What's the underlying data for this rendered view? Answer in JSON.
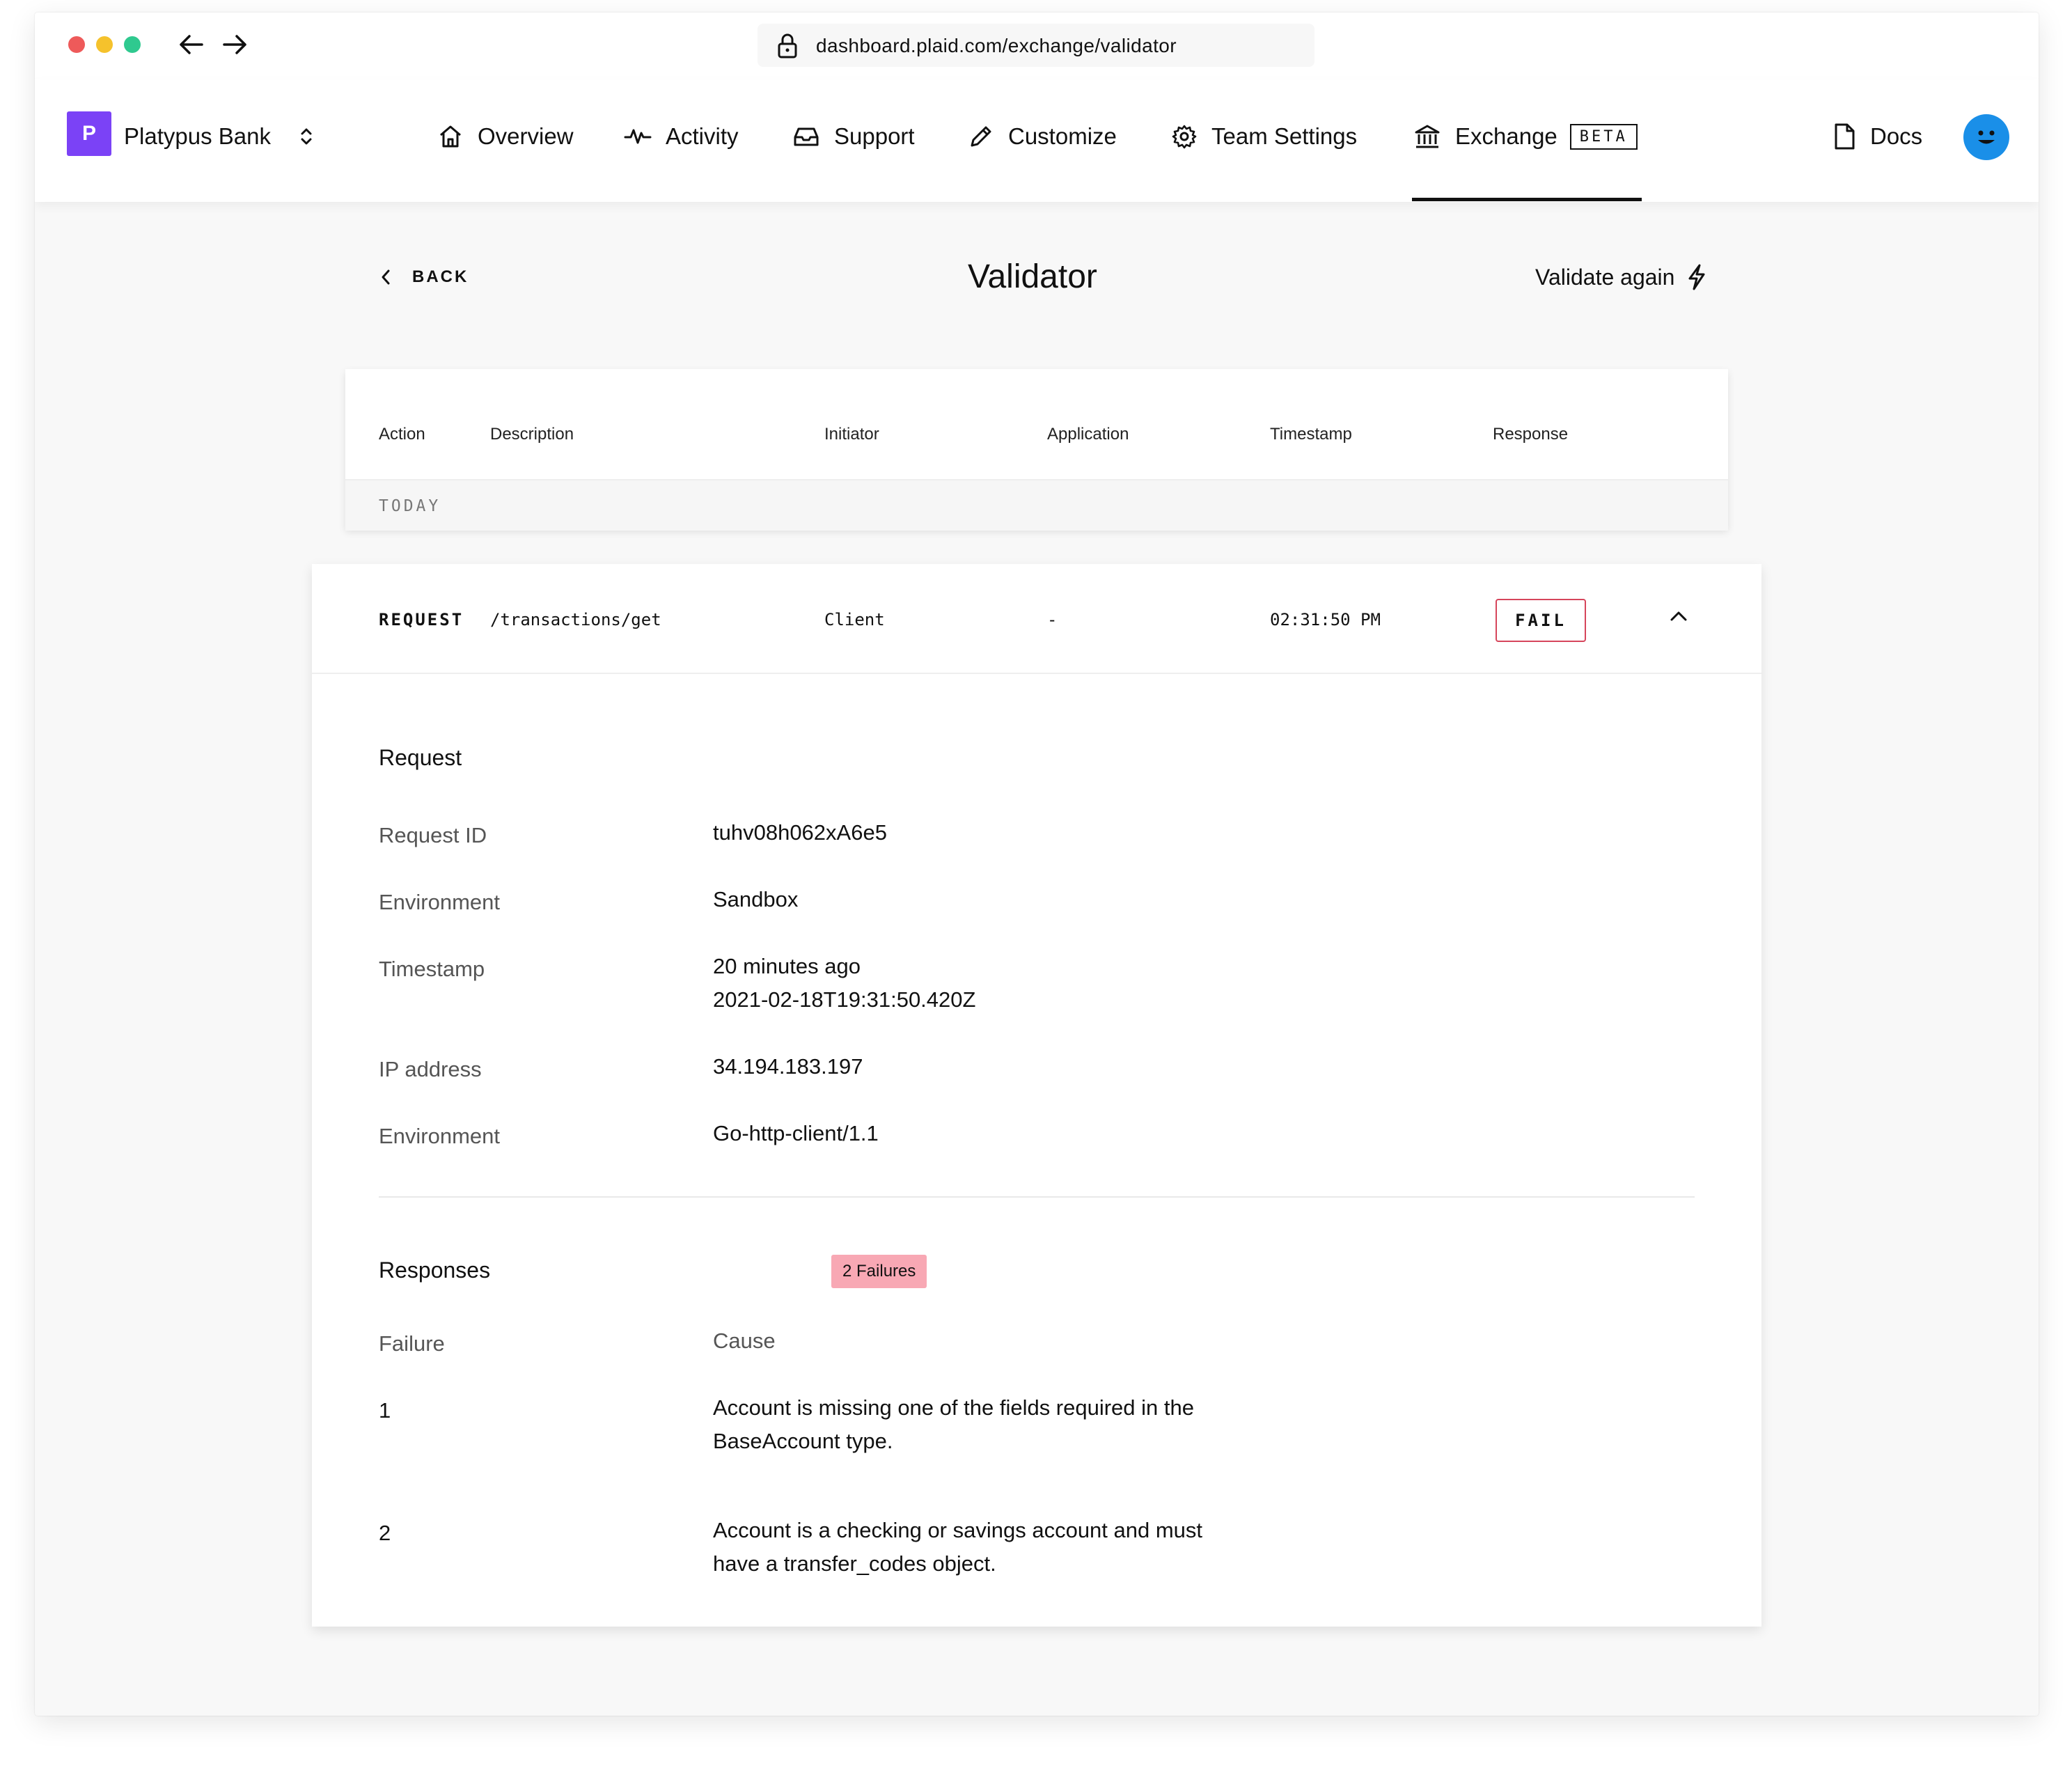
{
  "browser": {
    "url": "dashboard.plaid.com/exchange/validator",
    "dots": [
      "#ee5a5a",
      "#f5c22c",
      "#2fc98f"
    ]
  },
  "nav": {
    "org_initial": "P",
    "org_name": "Platypus Bank",
    "items": {
      "overview": "Overview",
      "activity": "Activity",
      "support": "Support",
      "customize": "Customize",
      "team_settings": "Team Settings",
      "exchange": "Exchange",
      "exchange_badge": "BETA",
      "docs": "Docs"
    },
    "brand_color": "#7b42f6",
    "avatar_color": "#1a8fe8"
  },
  "header": {
    "back_label": "BACK",
    "title": "Validator",
    "validate_label": "Validate again"
  },
  "table": {
    "columns": [
      "Action",
      "Description",
      "Initiator",
      "Application",
      "Timestamp",
      "Response"
    ],
    "group_label": "TODAY",
    "row": {
      "action": "REQUEST",
      "description": "/transactions/get",
      "initiator": "Client",
      "application": "-",
      "timestamp": "02:31:50 PM",
      "response": "FAIL"
    }
  },
  "request": {
    "title": "Request",
    "fields": [
      {
        "label": "Request ID",
        "value": "tuhv08h062xA6e5"
      },
      {
        "label": "Environment",
        "value": "Sandbox"
      },
      {
        "label": "Timestamp",
        "value": "20 minutes ago",
        "value2": "2021-02-18T19:31:50.420Z"
      },
      {
        "label": "IP address",
        "value": "34.194.183.197"
      },
      {
        "label": "Environment",
        "value": "Go-http-client/1.1"
      }
    ]
  },
  "responses": {
    "title": "Responses",
    "badge": "2 Failures",
    "badge_color": "#f8a8b4",
    "col_failure": "Failure",
    "col_cause": "Cause",
    "items": [
      {
        "num": "1",
        "line1": "Account is missing one of the fields required in the",
        "line2": "BaseAccount type."
      },
      {
        "num": "2",
        "line1": "Account is a checking or savings account and must",
        "line2": "have a transfer_codes object."
      }
    ]
  }
}
